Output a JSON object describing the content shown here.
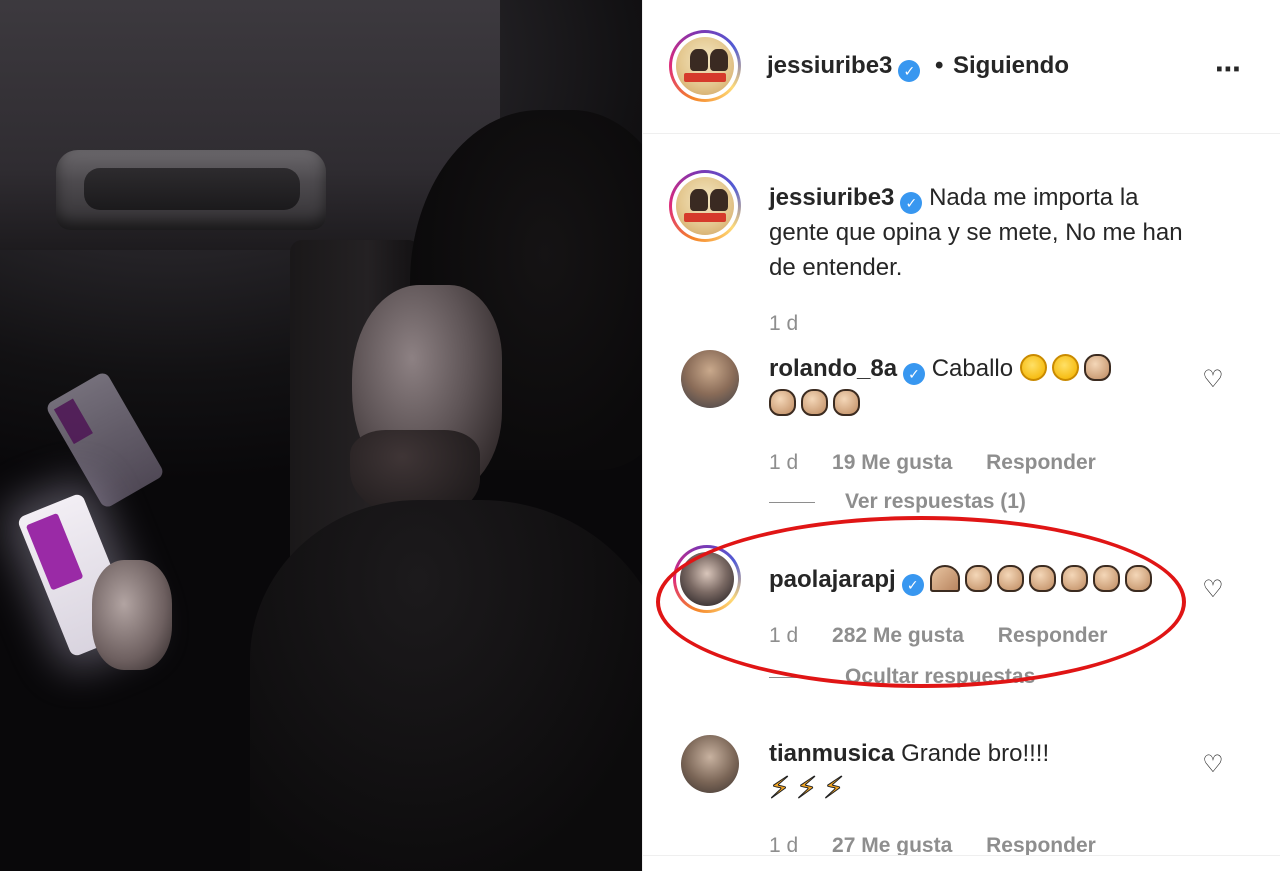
{
  "post": {
    "author": "jessiuribe3",
    "follow_separator": "•",
    "follow_status": "Siguiendo",
    "more_icon": "⋯"
  },
  "caption": {
    "username": "jessiuribe3",
    "text": "Nada me importa la gente que opina y se mete, No me han de entender.",
    "time": "1 d"
  },
  "comments": [
    {
      "username": "rolando_8a",
      "text": "Caballo",
      "emojis": [
        "hugging-face",
        "hugging-face",
        "clapping-hands",
        "clapping-hands",
        "clapping-hands",
        "clapping-hands"
      ],
      "time": "1 d",
      "likes": "19 Me gusta",
      "reply": "Responder",
      "replies_toggle": "Ver respuestas (1)"
    },
    {
      "username": "paolajarapj",
      "text": "",
      "emojis": [
        "folded-hands",
        "clapping-hands",
        "clapping-hands",
        "clapping-hands",
        "clapping-hands",
        "clapping-hands",
        "clapping-hands"
      ],
      "time": "1 d",
      "likes": "282 Me gusta",
      "reply": "Responder",
      "replies_toggle": "Ocultar respuestas"
    },
    {
      "username": "tianmusica",
      "text": "Grande bro!!!!",
      "emojis": [
        "high-voltage",
        "high-voltage",
        "high-voltage"
      ],
      "time": "1 d",
      "likes": "27 Me gusta",
      "reply": "Responder"
    }
  ],
  "colors": {
    "verified": "#3897f0",
    "highlight_ring": "#e01515",
    "meta_text": "#8e8e8e"
  }
}
